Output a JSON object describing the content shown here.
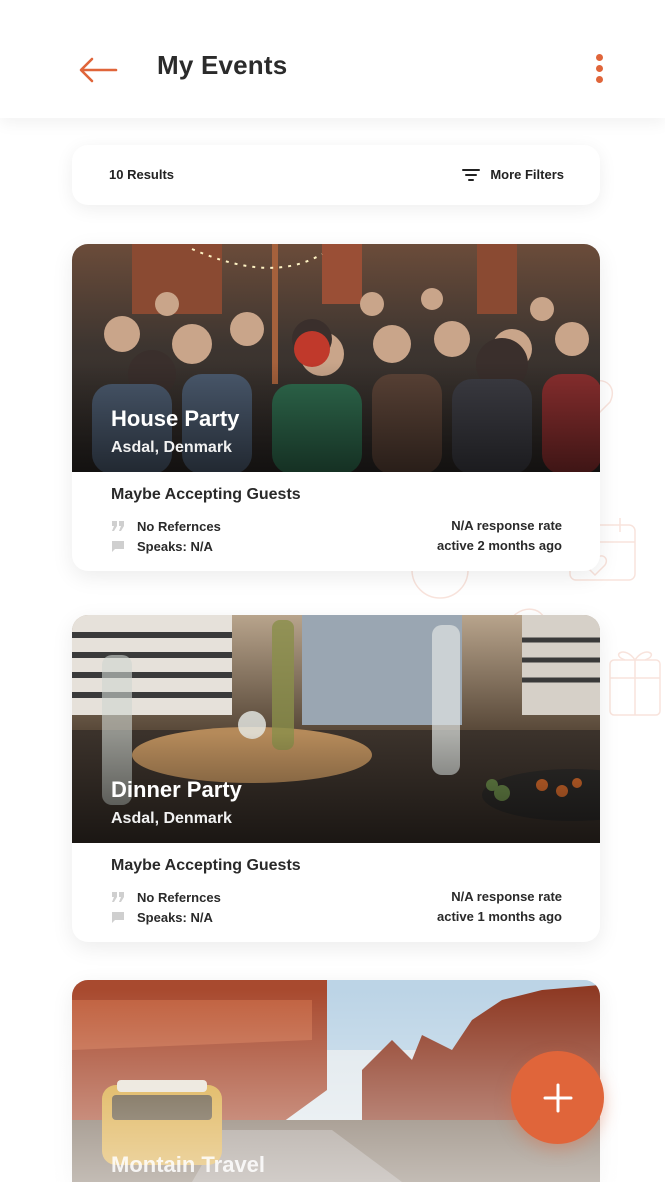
{
  "header": {
    "title": "My Events",
    "back_icon": "arrow-left-icon",
    "menu_icon": "kebab-menu-icon"
  },
  "results": {
    "count_label": "10 Results",
    "filters_label": "More Filters",
    "filters_icon": "filter-icon"
  },
  "events": [
    {
      "title": "House Party",
      "location": "Asdal, Denmark",
      "status": "Maybe Accepting Guests",
      "references": "No Refernces",
      "speaks": "Speaks:  N/A",
      "response_rate": "N/A response rate",
      "active": "active 2 months ago"
    },
    {
      "title": "Dinner Party",
      "location": "Asdal, Denmark",
      "status": "Maybe Accepting Guests",
      "references": "No Refernces",
      "speaks": "Speaks:  N/A",
      "response_rate": "N/A response rate",
      "active": "active 1 months ago"
    },
    {
      "title": "Montain Travel"
    }
  ],
  "fab": {
    "icon": "plus-icon"
  },
  "colors": {
    "accent": "#e0653a",
    "text": "#222222",
    "background": "#ffffff"
  }
}
